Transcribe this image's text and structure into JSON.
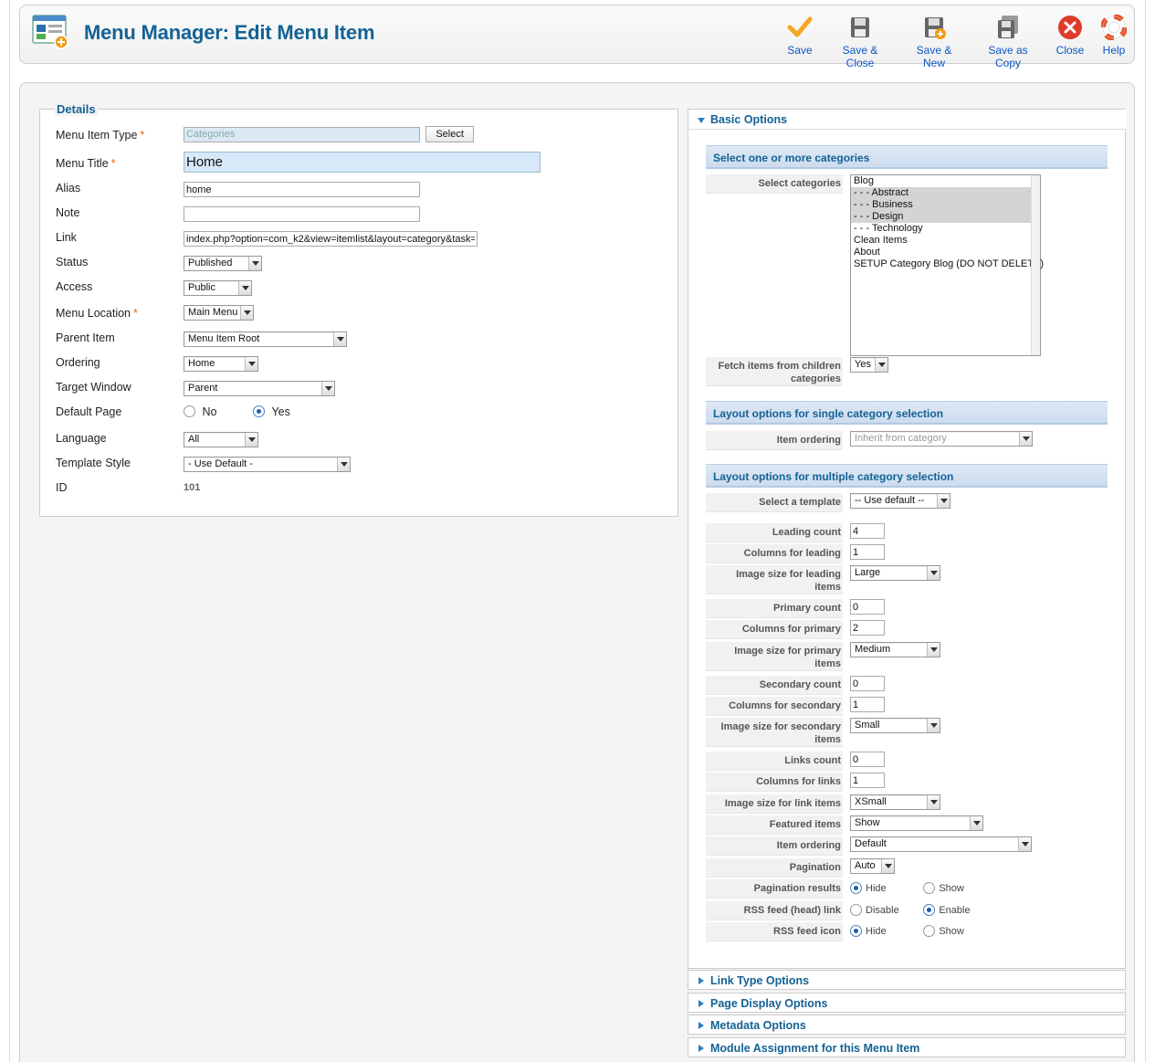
{
  "toolbar": {
    "title": "Menu Manager: Edit Menu Item",
    "buttons": {
      "save": "Save",
      "save_close": "Save & Close",
      "save_new": "Save & New",
      "save_copy": "Save as Copy",
      "close": "Close",
      "help": "Help"
    }
  },
  "details": {
    "legend": "Details",
    "menu_item_type": {
      "label": "Menu Item Type",
      "value": "Categories",
      "button": "Select"
    },
    "menu_title": {
      "label": "Menu Title",
      "value": "Home"
    },
    "alias": {
      "label": "Alias",
      "value": "home"
    },
    "note": {
      "label": "Note",
      "value": ""
    },
    "link": {
      "label": "Link",
      "value": "index.php?option=com_k2&view=itemlist&layout=category&task="
    },
    "status": {
      "label": "Status",
      "value": "Published"
    },
    "access": {
      "label": "Access",
      "value": "Public"
    },
    "menu_location": {
      "label": "Menu Location",
      "value": "Main Menu"
    },
    "parent_item": {
      "label": "Parent Item",
      "value": "Menu Item Root"
    },
    "ordering": {
      "label": "Ordering",
      "value": "Home"
    },
    "target_window": {
      "label": "Target Window",
      "value": "Parent"
    },
    "default_page": {
      "label": "Default Page",
      "no": "No",
      "yes": "Yes",
      "selected": "Yes"
    },
    "language": {
      "label": "Language",
      "value": "All"
    },
    "template_style": {
      "label": "Template Style",
      "value": "- Use Default -"
    },
    "id": {
      "label": "ID",
      "value": "101"
    }
  },
  "basic_options": {
    "header": "Basic Options",
    "section1": "Select one or more categories",
    "select_categories_label": "Select categories",
    "categories": [
      "Blog",
      "- - - Abstract",
      "- - - Business",
      "- - - Design",
      "- - - Technology",
      "Clean Items",
      "About",
      "SETUP Category Blog (DO NOT DELETE)"
    ],
    "selected_categories": [
      "- - - Abstract",
      "- - - Business",
      "- - - Design"
    ],
    "fetch_children": {
      "label": "Fetch items from children categories",
      "value": "Yes"
    },
    "section2": "Layout options for single category selection",
    "item_ordering_single": {
      "label": "Item ordering",
      "value": "Inherit from category"
    },
    "section3": "Layout options for multiple category selection",
    "select_template": {
      "label": "Select a template",
      "value": "-- Use default --"
    },
    "leading_count": {
      "label": "Leading count",
      "value": "4"
    },
    "columns_leading": {
      "label": "Columns for leading",
      "value": "1"
    },
    "image_size_leading": {
      "label": "Image size for leading items",
      "value": "Large"
    },
    "primary_count": {
      "label": "Primary count",
      "value": "0"
    },
    "columns_primary": {
      "label": "Columns for primary",
      "value": "2"
    },
    "image_size_primary": {
      "label": "Image size for primary items",
      "value": "Medium"
    },
    "secondary_count": {
      "label": "Secondary count",
      "value": "0"
    },
    "columns_secondary": {
      "label": "Columns for secondary",
      "value": "1"
    },
    "image_size_secondary": {
      "label": "Image size for secondary items",
      "value": "Small"
    },
    "links_count": {
      "label": "Links count",
      "value": "0"
    },
    "columns_links": {
      "label": "Columns for links",
      "value": "1"
    },
    "image_size_links": {
      "label": "Image size for link items",
      "value": "XSmall"
    },
    "featured_items": {
      "label": "Featured items",
      "value": "Show"
    },
    "item_ordering_multi": {
      "label": "Item ordering",
      "value": "Default"
    },
    "pagination": {
      "label": "Pagination",
      "value": "Auto"
    },
    "pagination_results": {
      "label": "Pagination results",
      "opt1": "Hide",
      "opt2": "Show",
      "selected": "Hide"
    },
    "rss_link": {
      "label": "RSS feed (head) link",
      "opt1": "Disable",
      "opt2": "Enable",
      "selected": "Enable"
    },
    "rss_icon": {
      "label": "RSS feed icon",
      "opt1": "Hide",
      "opt2": "Show",
      "selected": "Hide"
    }
  },
  "collapsed_panels": {
    "link_type": "Link Type Options",
    "page_display": "Page Display Options",
    "metadata": "Metadata Options",
    "module_assignment": "Module Assignment for this Menu Item"
  },
  "colors": {
    "title": "#146295",
    "link": "#0b55c4",
    "required": "#ee6600"
  }
}
